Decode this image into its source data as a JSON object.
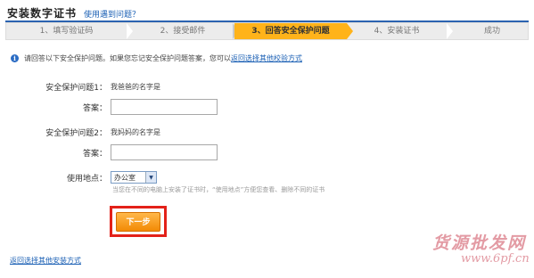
{
  "header": {
    "title": "安装数字证书",
    "help_link": "使用遇到问题？"
  },
  "steps": [
    {
      "label": "1、填写验证码",
      "active": false
    },
    {
      "label": "2、接受邮件",
      "active": false
    },
    {
      "label": "3、回答安全保护问题",
      "active": true
    },
    {
      "label": "4、安装证书",
      "active": false
    },
    {
      "label": "成功",
      "active": false
    }
  ],
  "notice": {
    "icon": "info-icon",
    "text": "请回答以下安全保护问题。如果您忘记安全保护问题答案，您可以",
    "link": "返回选择其他校验方式"
  },
  "form": {
    "q1_label": "安全保护问题1：",
    "q1_value": "我爸爸的名字是",
    "answer1_label": "答案：",
    "answer1_value": "",
    "q2_label": "安全保护问题2：",
    "q2_value": "我妈妈的名字是",
    "answer2_label": "答案：",
    "answer2_value": "",
    "location_label": "使用地点：",
    "location_selected": "办公室",
    "location_hint": "当您在不同的电脑上安装了证书时，“使用地点”方便您查看、删除不同的证书"
  },
  "next_button": "下一步",
  "back_link": "返回选择其他安装方式",
  "watermark": {
    "text": "货源批发网",
    "domain": "www.6pf.cn"
  },
  "colors": {
    "accent": "#2b63b0",
    "active_step": "#ffb31a",
    "button": "#f28a05",
    "highlight_border": "#e32119",
    "watermark": "#e39ba4"
  }
}
